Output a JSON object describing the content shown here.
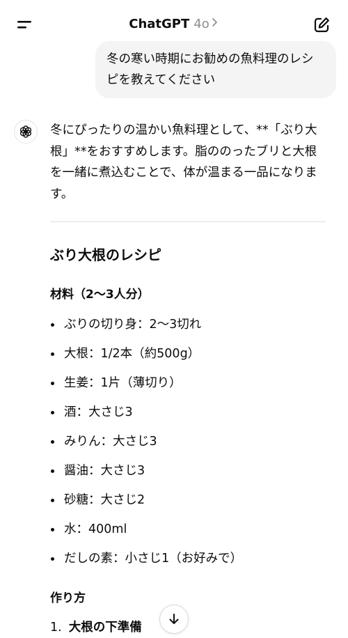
{
  "header": {
    "app_name": "ChatGPT",
    "model": "4o"
  },
  "conversation": {
    "user_message": "冬の寒い時期にお勧めの魚料理のレシピを教えてください",
    "assistant": {
      "intro": "冬にぴったりの温かい魚料理として、**「ぶり大根」**をおすすめします。脂ののったブリと大根を一緒に煮込むことで、体が温まる一品になります。",
      "recipe_title": "ぶり大根のレシピ",
      "ingredients_heading": "材料（2〜3人分）",
      "ingredients": [
        "ぶりの切り身：2〜3切れ",
        "大根：1/2本（約500g）",
        "生姜：1片（薄切り）",
        "酒：大さじ3",
        "みりん：大さじ3",
        "醤油：大さじ3",
        "砂糖：大さじ2",
        "水：400ml",
        "だしの素：小さじ1（お好みで）"
      ],
      "method_heading": "作り方",
      "steps": [
        {
          "number": "1.",
          "title": "大根の下準備"
        }
      ]
    }
  },
  "icons": {
    "menu": "menu-icon",
    "model_chevron": "chevron-right-icon",
    "new_chat": "new-chat-icon",
    "assistant_avatar": "openai-logo-icon",
    "scroll_down": "arrow-down-icon"
  }
}
